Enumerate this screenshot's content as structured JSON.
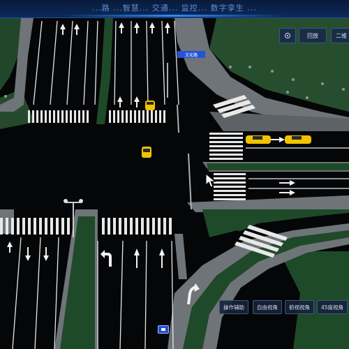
{
  "header": {
    "title": "...路 ...智慧... 交通... 监控... 数字孪生 ..."
  },
  "controls": {
    "locate_icon": "locate-icon",
    "reset_label": "回放",
    "view_2d_label": "二维"
  },
  "street_sign": {
    "label": "文化路"
  },
  "view_buttons": {
    "assist": "操作辅助",
    "free": "自由视角",
    "top": "俯视视角",
    "angle45": "45度视角"
  },
  "colors": {
    "road": "#050608",
    "sidewalk": "#6f7478",
    "grass": "#1e4a2a",
    "lane_marking": "#e8e8e8",
    "car": "#f2c200",
    "accent": "#2f8cff"
  }
}
